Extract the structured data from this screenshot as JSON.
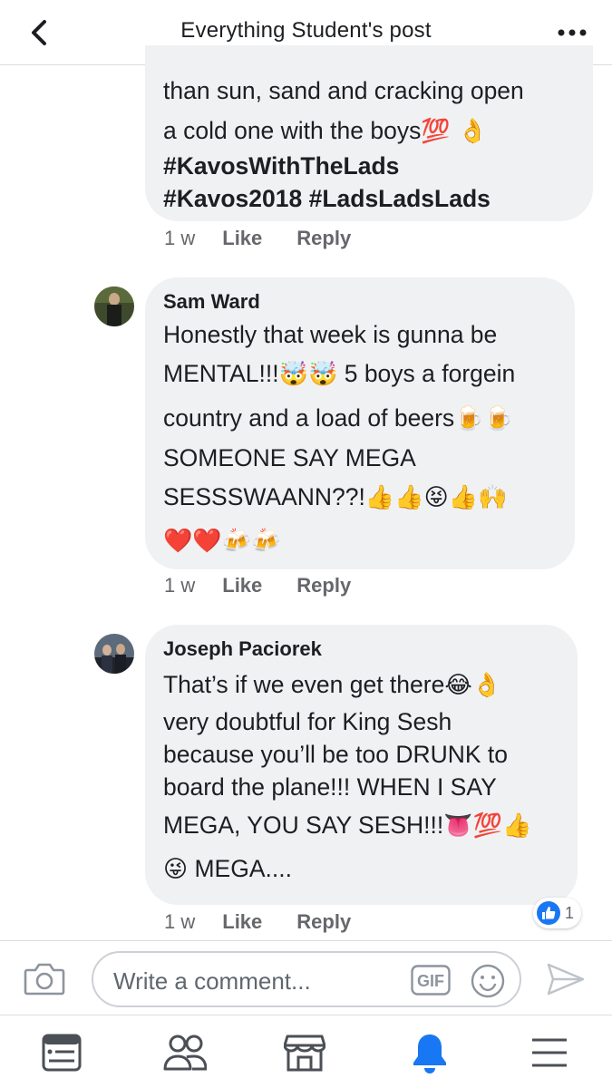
{
  "header": {
    "title": "Everything Student's post"
  },
  "comments": [
    {
      "text_line1": "than sun, sand and cracking open",
      "text_line2": "a cold one with the boys",
      "emoji_line2": "💯 👌",
      "hashtags_line1": "#KavosWithTheLads",
      "hashtags_line2": "#Kavos2018 #LadsLadsLads",
      "time": "1 w",
      "like_label": "Like",
      "reply_label": "Reply"
    },
    {
      "author": "Sam Ward",
      "line1": "Honestly that week is gunna be",
      "line2_text": "MENTAL!!!",
      "line2_emoji": "🤯🤯",
      "line2_rest": " 5 boys a forgein",
      "line3_text": "country and a load of beers",
      "line3_emoji": "🍺🍺",
      "line4": "SOMEONE SAY MEGA",
      "line5_text": "SESSSWAANN??!",
      "line5_emoji": "👍👍😝👍🙌",
      "line6_emoji": "❤️❤️🍻🍻",
      "time": "1 w",
      "like_label": "Like",
      "reply_label": "Reply"
    },
    {
      "author": "Joseph Paciorek",
      "line1_text": "That’s if we even get there",
      "line1_emoji": "😂👌",
      "line2": "very doubtful for King Sesh",
      "line3": "because you’ll be too DRUNK to",
      "line4": "board the plane!!! WHEN I SAY",
      "line5_text": "MEGA, YOU SAY SESH!!!",
      "line5_emoji": "👅💯👍",
      "line6_emoji": "😜",
      "line6_text": " MEGA....",
      "time": "1 w",
      "like_label": "Like",
      "reply_label": "Reply",
      "reaction_count": "1"
    }
  ],
  "composer": {
    "placeholder": "Write a comment...",
    "gif_label": "GIF"
  },
  "colors": {
    "accent": "#1877f2",
    "bubble": "#f0f1f3",
    "meta_text": "#65676b"
  },
  "tabs": [
    {
      "icon": "news-feed-icon"
    },
    {
      "icon": "friends-icon"
    },
    {
      "icon": "marketplace-icon"
    },
    {
      "icon": "notifications-bell-icon",
      "active": true
    },
    {
      "icon": "menu-icon"
    }
  ]
}
